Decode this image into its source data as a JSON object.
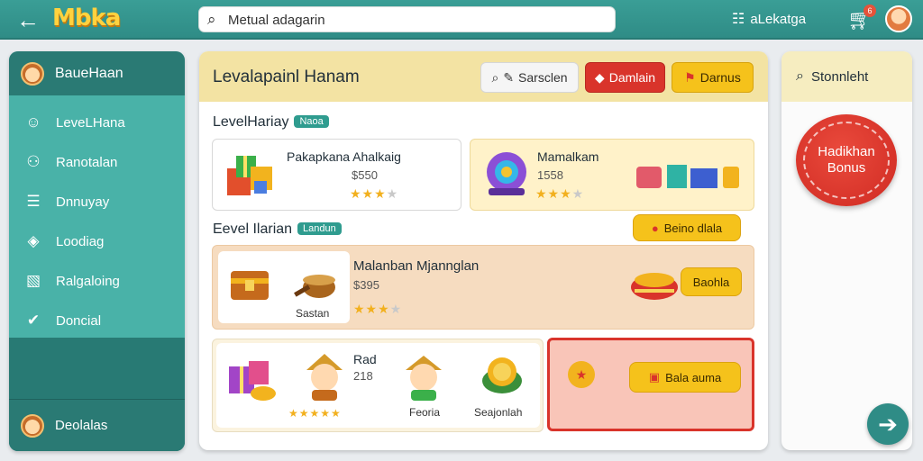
{
  "topbar": {
    "logo": "Mbka",
    "search_value": "Metual adagarin",
    "account_label": "aLekatga",
    "cart_badge": "6"
  },
  "sidebar": {
    "header": "BaueHaan",
    "items": [
      {
        "label": "LeveLHana",
        "icon": "person-icon"
      },
      {
        "label": "Ranotalan",
        "icon": "user-icon"
      },
      {
        "label": "Dnnuyay",
        "icon": "list-icon"
      },
      {
        "label": "Loodiag",
        "icon": "shield-icon"
      },
      {
        "label": "Ralgaloing",
        "icon": "chart-icon"
      },
      {
        "label": "Doncial",
        "icon": "check-icon"
      }
    ],
    "footer": "Deolalas"
  },
  "main": {
    "title": "Levalapainl Hanam",
    "search_button": "Sarsclen",
    "red_button": "Damlain",
    "yellow_button": "Darnus",
    "section1": {
      "label": "LevelHariay",
      "tag": "Naoa"
    },
    "card1": {
      "name": "Pakapkana Ahalkaig",
      "price": "$550",
      "rating": 3
    },
    "card2": {
      "name": "Mamalkam",
      "price": "1558",
      "rating": 3
    },
    "section2": {
      "label": "Eevel Ilarian",
      "tag": "Landun"
    },
    "pill_label": "Beino dlala",
    "card3": {
      "name": "Malanban Mjannglan",
      "price": "$395",
      "caption": "Sastan",
      "rating": 3,
      "button": "Baohla"
    },
    "card4": {
      "name": "Rad",
      "price": "218",
      "rating": 5,
      "caption1": "Feoria",
      "caption2": "Seajonlah"
    },
    "card5": {
      "button": "Bala auma"
    }
  },
  "right": {
    "header": "Stonnleht",
    "bonus_line1": "Hadikhan",
    "bonus_line2": "Bonus"
  }
}
